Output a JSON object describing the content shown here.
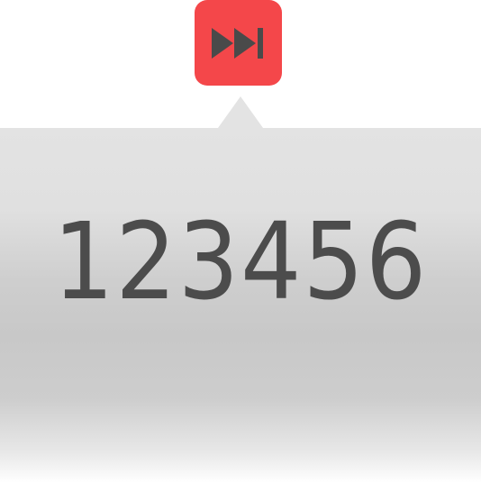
{
  "skip_button": {
    "icon": "skip-forward-icon",
    "background_color": "#f4474a",
    "icon_color": "#4a4a4a"
  },
  "popover": {
    "background_color": "#e3e3e3",
    "counter_value": "123456",
    "text_color": "#4c4c4c"
  }
}
